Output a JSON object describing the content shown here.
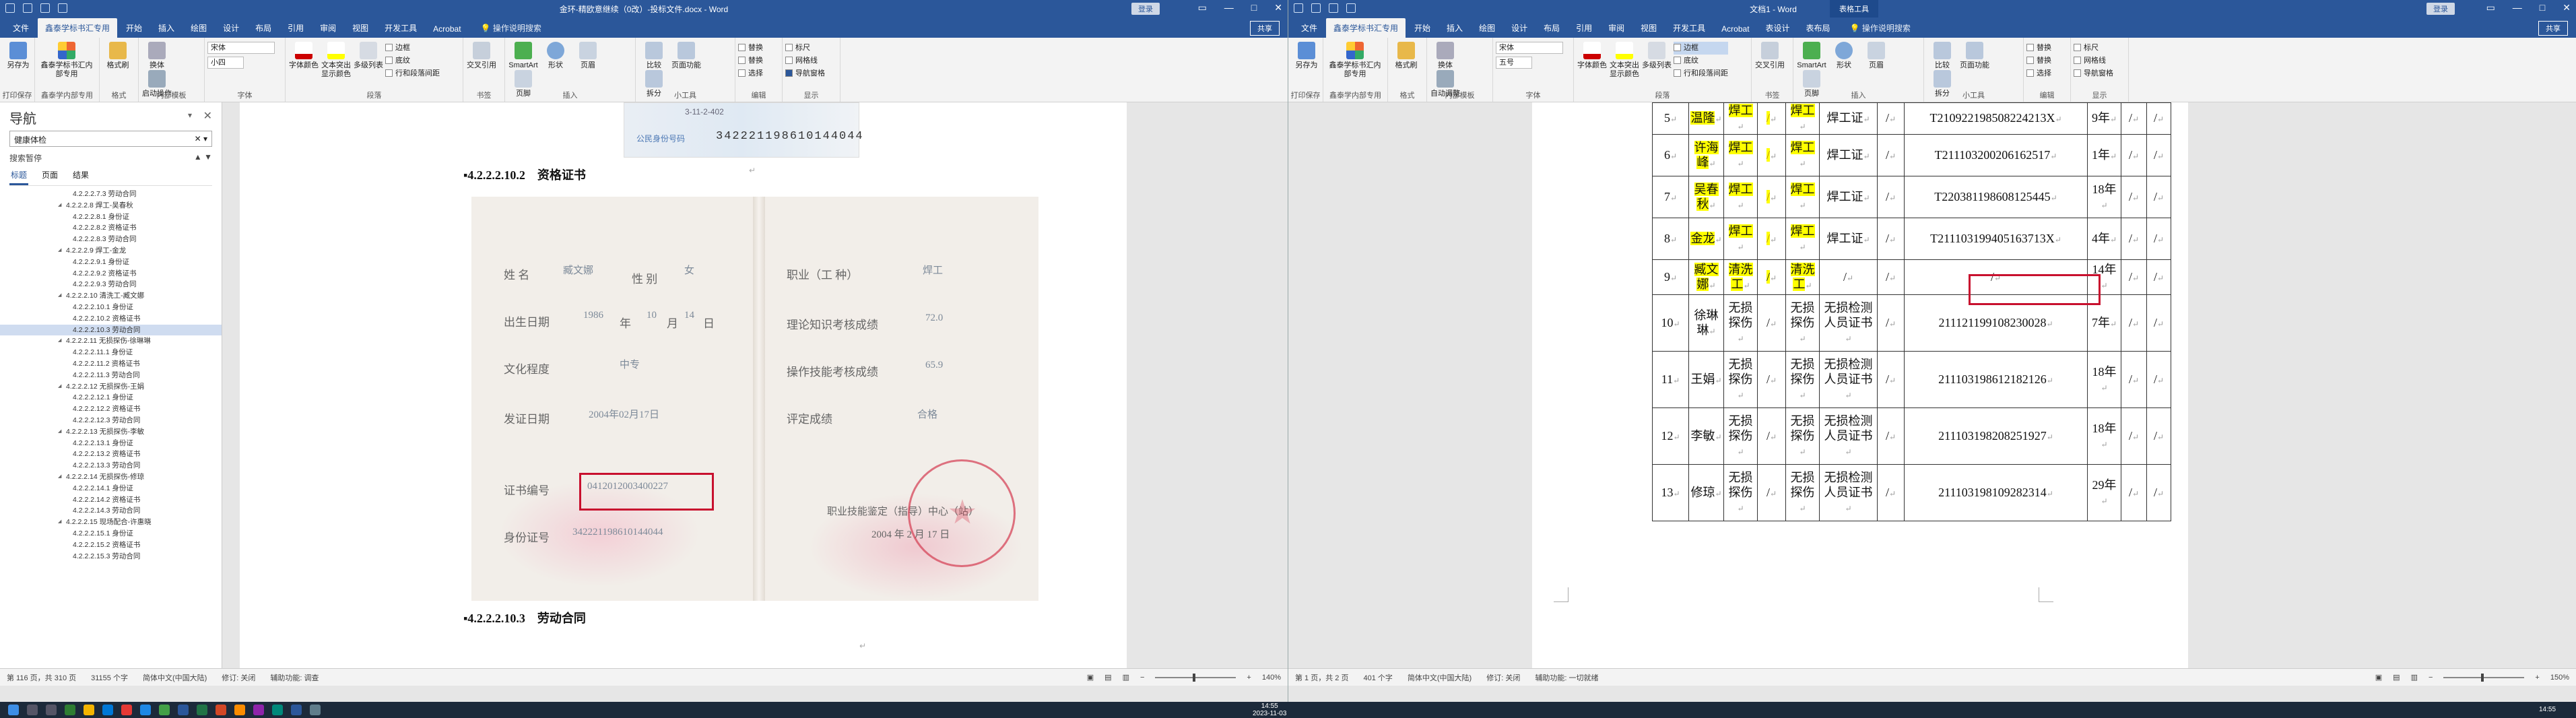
{
  "left_window": {
    "title": "金环-精欧意继续（0改）-投标文件.docx - Word",
    "user": "登录",
    "tabs": [
      "文件",
      "鑫泰学标书汇专用",
      "开始",
      "插入",
      "绘图",
      "设计",
      "布局",
      "引用",
      "审阅",
      "视图",
      "开发工具",
      "Acrobat"
    ],
    "tell_me": "操作说明搜索",
    "share": "共享",
    "ribbon": {
      "g_print": {
        "btn": "另存为",
        "label": "打印保存"
      },
      "g_tool": {
        "btn": "鑫泰学标书汇内部专用",
        "label": "鑫泰学内部专用"
      },
      "g_style": {
        "btn": "格式刷",
        "label": "格式"
      },
      "g_body": {
        "btns": [
          "换体",
          "启动操作"
        ],
        "label": "内部模板"
      },
      "g_font": {
        "name": "宋体",
        "size": "小四",
        "label": "字体"
      },
      "g_para": {
        "btns": [
          "字体颜色",
          "文本突出显示颜色",
          "多级列表"
        ],
        "smalls": [
          "边框",
          "底纹",
          "行和段落间距"
        ],
        "label": "段落"
      },
      "g_ref": {
        "btn": "交叉引用",
        "label": "书签"
      },
      "g_insert": {
        "btns": [
          "SmartArt",
          "形状",
          "页眉",
          "页脚"
        ],
        "label": "插入"
      },
      "g_tools": {
        "btns": [
          "比较",
          "页面功能",
          "拆分"
        ],
        "label": "小工具"
      },
      "g_edit": {
        "smalls": [
          "替换",
          "替换",
          "选择"
        ],
        "label": "编辑"
      },
      "g_show": {
        "smalls": [
          "标尺",
          "网格线",
          "导航窗格"
        ],
        "label": "显示"
      }
    },
    "nav": {
      "title": "导航",
      "search": "健康体检",
      "subtitle": "搜索暂停",
      "tabs": [
        "标题",
        "页面",
        "结果"
      ],
      "items": [
        {
          "t": "4.2.2.2.7.3 劳动合同",
          "lv": 1
        },
        {
          "t": "4.2.2.2.8 焊工-吴春秋",
          "lv": 0
        },
        {
          "t": "4.2.2.2.8.1 身份证",
          "lv": 1
        },
        {
          "t": "4.2.2.2.8.2 资格证书",
          "lv": 1
        },
        {
          "t": "4.2.2.2.8.3 劳动合同",
          "lv": 1
        },
        {
          "t": "4.2.2.2.9 焊工-金龙",
          "lv": 0
        },
        {
          "t": "4.2.2.2.9.1 身份证",
          "lv": 1
        },
        {
          "t": "4.2.2.2.9.2 资格证书",
          "lv": 1
        },
        {
          "t": "4.2.2.2.9.3 劳动合同",
          "lv": 1
        },
        {
          "t": "4.2.2.2.10 清洗工-臧文娜",
          "lv": 0
        },
        {
          "t": "4.2.2.2.10.1 身份证",
          "lv": 1
        },
        {
          "t": "4.2.2.2.10.2 资格证书",
          "lv": 1
        },
        {
          "t": "4.2.2.2.10.3 劳动合同",
          "lv": 1,
          "sel": true
        },
        {
          "t": "4.2.2.2.11 无损探伤-徐琳琳",
          "lv": 0
        },
        {
          "t": "4.2.2.2.11.1 身份证",
          "lv": 1
        },
        {
          "t": "4.2.2.2.11.2 资格证书",
          "lv": 1
        },
        {
          "t": "4.2.2.2.11.3 劳动合同",
          "lv": 1
        },
        {
          "t": "4.2.2.2.12 无损探伤-王娟",
          "lv": 0
        },
        {
          "t": "4.2.2.2.12.1 身份证",
          "lv": 1
        },
        {
          "t": "4.2.2.2.12.2 资格证书",
          "lv": 1
        },
        {
          "t": "4.2.2.2.12.3 劳动合同",
          "lv": 1
        },
        {
          "t": "4.2.2.2.13 无损探伤-李敏",
          "lv": 0
        },
        {
          "t": "4.2.2.2.13.1 身份证",
          "lv": 1
        },
        {
          "t": "4.2.2.2.13.2 资格证书",
          "lv": 1
        },
        {
          "t": "4.2.2.2.13.3 劳动合同",
          "lv": 1
        },
        {
          "t": "4.2.2.2.14 无损探伤-修琼",
          "lv": 0
        },
        {
          "t": "4.2.2.2.14.1 身份证",
          "lv": 1
        },
        {
          "t": "4.2.2.2.14.2 资格证书",
          "lv": 1
        },
        {
          "t": "4.2.2.2.14.3 劳动合同",
          "lv": 1
        },
        {
          "t": "4.2.2.2.15 现场配合-许惠晓",
          "lv": 0
        },
        {
          "t": "4.2.2.2.15.1 身份证",
          "lv": 1
        },
        {
          "t": "4.2.2.2.15.2 资格证书",
          "lv": 1
        },
        {
          "t": "4.2.2.2.15.3 劳动合同",
          "lv": 1
        }
      ]
    },
    "doc": {
      "id_card_tail": {
        "addr": "3-11-2-402",
        "label": "公民身份号码",
        "number": "342221198610144044"
      },
      "heading1": "▪4.2.2.2.10.2　资格证书",
      "heading2": "▪4.2.2.2.10.3　劳动合同",
      "cert": {
        "name_label": "姓 名",
        "name": "臧文娜",
        "sex_label": "性 别",
        "sex": "女",
        "birth_label": "出生日期",
        "birth_y": "1986",
        "birth_m": "10",
        "birth_d": "14",
        "y": "年",
        "m": "月",
        "d": "日",
        "edu_label": "文化程度",
        "edu": "中专",
        "issue_label": "发证日期",
        "issue": "2004年02月17日",
        "certno_label": "证书编号",
        "certno": "0412012003400227",
        "idno_label": "身份证号",
        "idno": "342221198610144044",
        "job_label": "职业（工 种）",
        "job": "焊工",
        "theory_label": "理论知识考核成绩",
        "theory": "72.0",
        "skill_label": "操作技能考核成绩",
        "skill": "65.9",
        "eval_label": "评定成绩",
        "eval": "合格",
        "org_label": "职业技能鉴定（指导）中心（站）",
        "org_date": "2004 年 2 月 17 日"
      }
    },
    "status": {
      "page": "第 116 页，共 310 页",
      "words": "31155 个字",
      "lang": "简体中文(中国大陆)",
      "track": "修订: 关闭",
      "a11y": "辅助功能: 调查",
      "zoom": "140%"
    }
  },
  "right_window": {
    "title": "文档1 - Word",
    "context": "表格工具",
    "user": "登录",
    "tabs": [
      "文件",
      "鑫泰学标书汇专用",
      "开始",
      "插入",
      "绘图",
      "设计",
      "布局",
      "引用",
      "审阅",
      "视图",
      "开发工具",
      "Acrobat",
      "表设计",
      "表布局"
    ],
    "tell_me": "操作说明搜索",
    "share": "共享",
    "ribbon": {
      "g_print": {
        "btn": "另存为",
        "label": "打印保存"
      },
      "g_tool": {
        "btn": "鑫泰学标书汇内部专用",
        "label": "鑫泰学内部专用"
      },
      "g_style": {
        "btn": "格式刷",
        "label": "格式"
      },
      "g_body": {
        "btns": [
          "换体",
          "自动调整"
        ],
        "label": "内部模板"
      },
      "g_font": {
        "name": "宋体",
        "size": "五号",
        "label": "字体"
      },
      "g_para": {
        "btns": [
          "字体颜色",
          "文本突出显示颜色",
          "多级列表"
        ],
        "smalls": [
          "边框",
          "底纹",
          "行和段落间距"
        ],
        "label": "段落"
      },
      "g_ref": {
        "btn": "交叉引用",
        "label": "书签"
      },
      "g_insert": {
        "btns": [
          "SmartArt",
          "形状",
          "页眉",
          "页脚"
        ],
        "label": "插入"
      },
      "g_tools": {
        "btns": [
          "比较",
          "页面功能",
          "拆分"
        ],
        "label": "小工具"
      },
      "g_edit": {
        "smalls": [
          "替换",
          "替换",
          "选择"
        ],
        "label": "编辑"
      },
      "g_show": {
        "smalls": [
          "标尺",
          "网格线",
          "导航窗格"
        ],
        "label": "显示"
      }
    },
    "table": {
      "rows": [
        {
          "no": "5",
          "name": "温隆",
          "type": "焊工",
          "slash": "/",
          "type2": "焊工",
          "cert": "焊工证",
          "c6": "/",
          "idno": "T210922198508224213X",
          "yrs": "9年",
          "c9": "/",
          "c10": "/",
          "hl": true
        },
        {
          "no": "6",
          "name": "许海峰",
          "type": "焊工",
          "slash": "/",
          "type2": "焊工",
          "cert": "焊工证",
          "c6": "/",
          "idno": "T211103200206162517",
          "yrs": "1年",
          "c9": "/",
          "c10": "/",
          "hl": true
        },
        {
          "no": "7",
          "name": "吴春秋",
          "type": "焊工",
          "slash": "/",
          "type2": "焊工",
          "cert": "焊工证",
          "c6": "/",
          "idno": "T220381198608125445",
          "yrs": "18年",
          "c9": "/",
          "c10": "/",
          "hl": true
        },
        {
          "no": "8",
          "name": "金龙",
          "type": "焊工",
          "slash": "/",
          "type2": "焊工",
          "cert": "焊工证",
          "c6": "/",
          "idno": "T211103199405163713X",
          "yrs": "4年",
          "c9": "/",
          "c10": "/",
          "hl": true
        },
        {
          "no": "9",
          "name": "臧文娜",
          "type": "清洗工",
          "slash": "/",
          "type2": "清洗工",
          "cert": "/",
          "c6": "/",
          "idno": "/",
          "yrs": "14年",
          "c9": "/",
          "c10": "/",
          "hl": true,
          "box": true
        },
        {
          "no": "10",
          "name": "徐琳琳",
          "type": "无损探伤",
          "slash": "/",
          "type2": "无损探伤",
          "cert": "无损检测人员证书",
          "c6": "/",
          "idno": "211121199108230028",
          "yrs": "7年",
          "c9": "/",
          "c10": "/"
        },
        {
          "no": "11",
          "name": "王娟",
          "type": "无损探伤",
          "slash": "/",
          "type2": "无损探伤",
          "cert": "无损检测人员证书",
          "c6": "/",
          "idno": "211103198612182126",
          "yrs": "18年",
          "c9": "/",
          "c10": "/"
        },
        {
          "no": "12",
          "name": "李敏",
          "type": "无损探伤",
          "slash": "/",
          "type2": "无损探伤",
          "cert": "无损检测人员证书",
          "c6": "/",
          "idno": "211103198208251927",
          "yrs": "18年",
          "c9": "/",
          "c10": "/"
        },
        {
          "no": "13",
          "name": "修琼",
          "type": "无损探伤",
          "slash": "/",
          "type2": "无损探伤",
          "cert": "无损检测人员证书",
          "c6": "/",
          "idno": "211103198109282314",
          "yrs": "29年",
          "c9": "/",
          "c10": "/"
        }
      ]
    },
    "status": {
      "page": "第 1 页，共 2 页",
      "words": "401 个字",
      "lang": "简体中文(中国大陆)",
      "track": "修订: 关闭",
      "a11y": "辅助功能: 一切就绪",
      "zoom": "150%"
    }
  },
  "taskbar": {
    "clock_time": "14:55",
    "clock_date": "2023-11-03",
    "clock_time2": "14:55"
  },
  "colors": {
    "accent": "#2b579a",
    "highlight": "#ffff00",
    "redbox": "#c8102e"
  }
}
